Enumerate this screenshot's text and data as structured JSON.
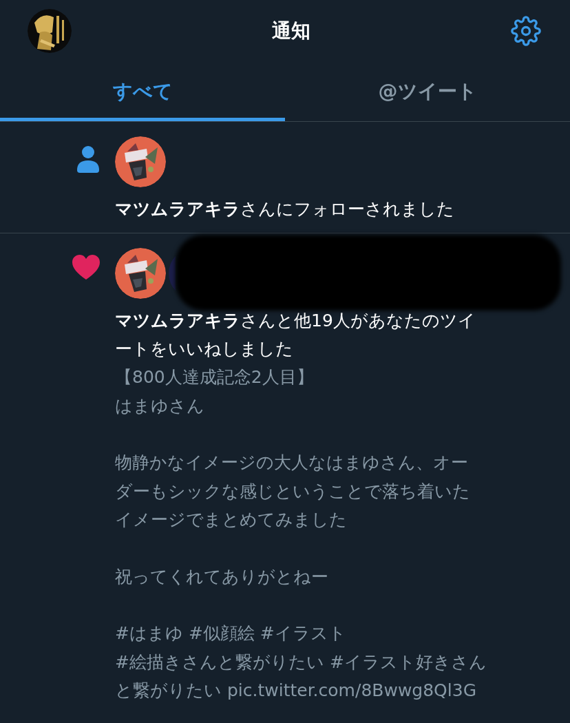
{
  "header": {
    "title": "通知"
  },
  "tabs": [
    {
      "label": "すべて",
      "selected": true
    },
    {
      "label": "@ツイート",
      "selected": false
    }
  ],
  "notifications": [
    {
      "kind": "follow",
      "avatars": [
        {
          "kind": "picture"
        }
      ],
      "text": [
        "**マツムラアキラ**さんにフォローされました"
      ]
    },
    {
      "kind": "like",
      "avatars": [
        {
          "kind": "picture"
        },
        {
          "kind": "picture"
        }
      ],
      "redacted": true,
      "text": [
        "**マツムラアキラ**さんと他19人があなたのツイ",
        "ートをいいねしました"
      ],
      "tweet": [
        [
          "【800人達成記念2人目】",
          "はまゆさん"
        ],
        [
          "物静かなイメージの大人なはまゆさん、オー",
          "ダーもシックな感じということで落ち着いた",
          "イメージでまとめてみました"
        ],
        [
          "祝ってくれてありがとねー"
        ],
        [
          "#はまゆ #似顔絵 #イラスト",
          "#絵描きさんと繋がりたい #イラスト好きさん",
          "と繋がりたい pic.twitter.com/8Bwwg8Ql3G"
        ]
      ]
    }
  ]
}
